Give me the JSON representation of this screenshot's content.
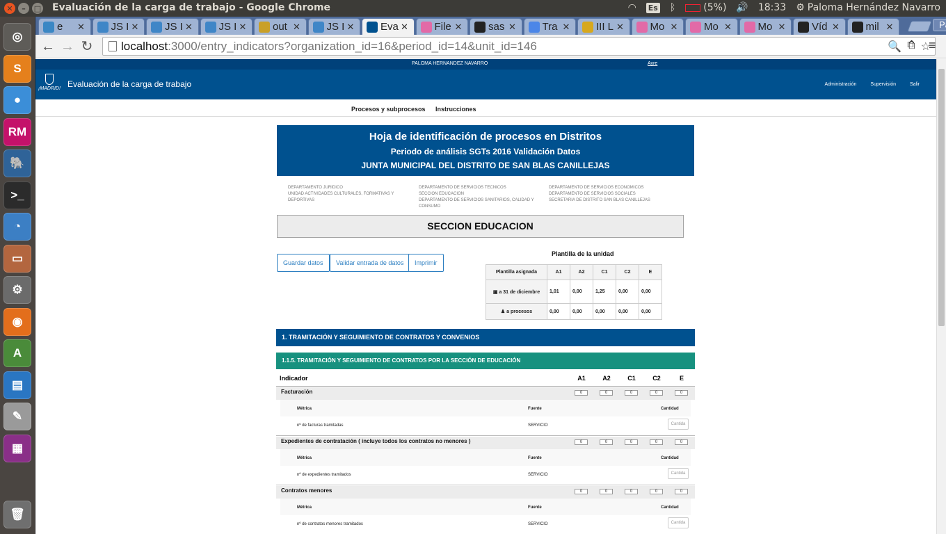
{
  "system": {
    "window_title": "Evaluación de la carga de trabajo - Google Chrome",
    "keyboard": "Es",
    "battery": "(5%)",
    "time": "18:33",
    "user": "Paloma Hernández Navarro"
  },
  "launcher": [
    {
      "name": "ubuntu-dash-icon",
      "glyph": "◎",
      "color": "#5e5c58"
    },
    {
      "name": "sublime-text-icon",
      "glyph": "S",
      "color": "#e5801c"
    },
    {
      "name": "chrome-icon",
      "glyph": "●",
      "color": "#3b8ed8"
    },
    {
      "name": "rubymine-icon",
      "glyph": "RM",
      "color": "#c4126a"
    },
    {
      "name": "pgadmin-icon",
      "glyph": "🐘",
      "color": "#2f6398"
    },
    {
      "name": "terminal-icon",
      "glyph": ">_",
      "color": "#2b2b2b"
    },
    {
      "name": "shotwell-icon",
      "glyph": "◔",
      "color": "#3c7fc4"
    },
    {
      "name": "files-icon",
      "glyph": "▭",
      "color": "#b3663f"
    },
    {
      "name": "system-settings-icon",
      "glyph": "⚙",
      "color": "#6b6b6b"
    },
    {
      "name": "firefox-icon",
      "glyph": "◉",
      "color": "#e36e1c"
    },
    {
      "name": "software-updater-icon",
      "glyph": "A",
      "color": "#4a8b3a"
    },
    {
      "name": "libreoffice-writer-icon",
      "glyph": "▤",
      "color": "#2a76c2"
    },
    {
      "name": "text-editor-icon",
      "glyph": "✎",
      "color": "#9a9a9a"
    },
    {
      "name": "workspace-switcher-icon",
      "glyph": "▦",
      "color": "#8a2f88"
    },
    {
      "name": "trash-icon",
      "glyph": "🗑",
      "color": "#6f6f6f"
    }
  ],
  "tabs": [
    {
      "label": "e",
      "color": "#3b87c4"
    },
    {
      "label": "JS I",
      "color": "#3f86c7"
    },
    {
      "label": "JS I",
      "color": "#3f86c7"
    },
    {
      "label": "JS I",
      "color": "#3f86c7"
    },
    {
      "label": "out",
      "color": "#c9a028"
    },
    {
      "label": "JS I",
      "color": "#3f86c7"
    },
    {
      "label": "Eva",
      "color": "#00518f",
      "active": true
    },
    {
      "label": "File",
      "color": "#e26aa7"
    },
    {
      "label": "sas",
      "color": "#222222"
    },
    {
      "label": "Tra",
      "color": "#4b86e8"
    },
    {
      "label": "III L",
      "color": "#d7a81e"
    },
    {
      "label": "Mo",
      "color": "#e26aa7"
    },
    {
      "label": "Mo",
      "color": "#e26aa7"
    },
    {
      "label": "Mo",
      "color": "#e26aa7"
    },
    {
      "label": "Víd",
      "color": "#222222"
    },
    {
      "label": "mil",
      "color": "#222222"
    }
  ],
  "profile": "Paloma",
  "omnibox": {
    "host": "localhost",
    "path": ":3000/entry_indicators?organization_id=16&period_id=14&unit_id=146"
  },
  "site": {
    "user_name": "PALOMA HERNANDEZ NAVARRO",
    "help": "Ayre",
    "title": "Evaluación de la carga de trabajo",
    "logo_text": "¡MADRID!",
    "nav": [
      "Administración",
      "Supervisión",
      "Salir"
    ],
    "subnav": [
      "Procesos y subprocesos",
      "Instrucciones"
    ]
  },
  "banner": {
    "line1": "Hoja de identificación de procesos en Distritos",
    "line2": "Periodo de análisis SGTs 2016 Validación Datos",
    "line3": "JUNTA MUNICIPAL DEL DISTRITO DE SAN BLAS CANILLEJAS"
  },
  "departments": {
    "col1": [
      "DEPARTAMENTO JURIDICO",
      "UNIDAD ACTIVIDADES CULTURALES, FORMATIVAS Y DEPORTIVAS"
    ],
    "col2": [
      "DEPARTAMENTO DE SERVICIOS TECNICOS",
      "SECCION EDUCACION",
      "DEPARTAMENTO DE SERVICIOS SANITARIOS, CALIDAD Y CONSUMO"
    ],
    "col3": [
      "DEPARTAMENTO DE SERVICIOS ECONOMICOS",
      "DEPARTAMENTO DE SERVICIOS SOCIALES",
      "SECRETARIA DE DISTRITO SAN BLAS CANILLEJAS"
    ]
  },
  "section_title": "SECCION EDUCACION",
  "buttons": {
    "save": "Guardar datos",
    "validate": "Validar entrada de datos",
    "print": "Imprimir"
  },
  "plantilla": {
    "title": "Plantilla de la unidad",
    "header": "Plantilla asignada",
    "categories": [
      "A1",
      "A2",
      "C1",
      "C2",
      "E"
    ],
    "rows": [
      {
        "label": "a 31 de diciembre",
        "icon": "calendar-icon",
        "values": [
          "1,01",
          "0,00",
          "1,25",
          "0,00",
          "0,00"
        ]
      },
      {
        "label": "a procesos",
        "icon": "user-icon",
        "values": [
          "0,00",
          "0,00",
          "0,00",
          "0,00",
          "0,00"
        ]
      }
    ]
  },
  "group": "1. TRAMITACIÓN Y SEGUIMIENTO DE CONTRATOS Y CONVENIOS",
  "subgroup": "1.1.5. TRAMITACIÓN Y SEGUIMIENTO DE CONTRATOS POR LA SECCIÓN DE EDUCACIÓN",
  "indicator_header": {
    "label": "Indicador",
    "categories": [
      "A1",
      "A2",
      "C1",
      "C2",
      "E"
    ]
  },
  "metric_header": {
    "metric": "Métrica",
    "source": "Fuente",
    "quantity": "Cantidad"
  },
  "indicators": [
    {
      "title": "Facturación",
      "counts": [
        "0",
        "0",
        "0",
        "0",
        "0"
      ],
      "metric": "nº de facturas tramitadas",
      "source": "SERVICIO",
      "placeholder": "Cantida"
    },
    {
      "title": "Expedientes de contratación ( incluye todos los contratos no menores )",
      "counts": [
        "0",
        "0",
        "0",
        "0",
        "0"
      ],
      "metric": "nº de expedientes tramitados",
      "source": "SERVICIO",
      "placeholder": "Cantida"
    },
    {
      "title": "Contratos menores",
      "counts": [
        "0",
        "0",
        "0",
        "0",
        "0"
      ],
      "metric": "nº de contratos menores tramitados",
      "source": "SERVICIO",
      "placeholder": "Cantida"
    }
  ]
}
